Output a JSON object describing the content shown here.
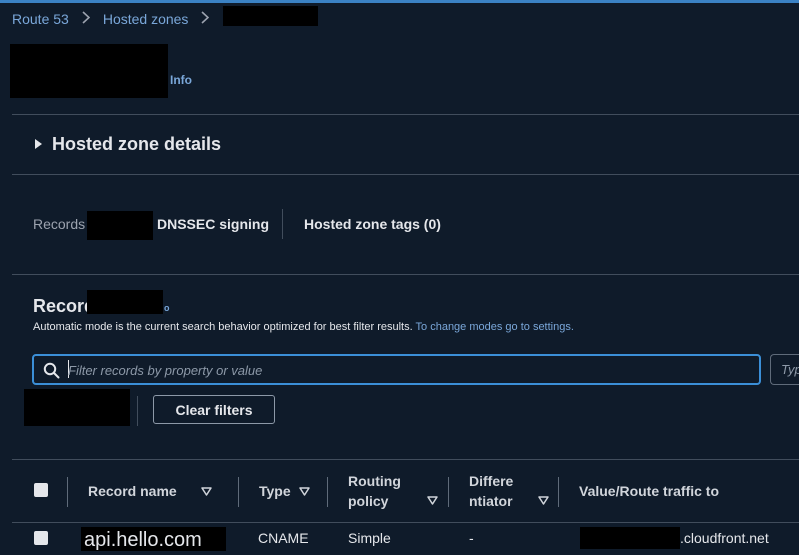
{
  "breadcrumb": {
    "items": [
      "Route 53",
      "Hosted zones"
    ]
  },
  "header": {
    "info_link": "Info"
  },
  "details_panel": {
    "title": "Hosted zone details"
  },
  "tabs": {
    "records": "Records",
    "dnssec": "DNSSEC signing",
    "tags": "Hosted zone tags (0)"
  },
  "records": {
    "title": "Records",
    "info_fragment": "o",
    "description": "Automatic mode is the current search behavior optimized for best filter results.",
    "description_link": "To change modes go to settings.",
    "search_placeholder": "Filter records by property or value",
    "type_select_fragment": "Typ",
    "clear_filters_label": "Clear filters",
    "columns": {
      "record_name": "Record name",
      "type": "Type",
      "routing_policy_line1": "Routing",
      "routing_policy_line2": "policy",
      "differentiator_line1": "Differe",
      "differentiator_line2": "ntiator",
      "value": "Value/Route traffic to"
    },
    "rows": [
      {
        "record_name": "api.hello.com",
        "type": "CNAME",
        "routing_policy": "Simple",
        "differentiator": "-",
        "value_suffix": ".cloudfront.net"
      }
    ]
  },
  "colors": {
    "background": "#0f1b2a",
    "link": "#7aa7d9",
    "focus_border": "#3b8fd8",
    "divider": "#414d5c"
  }
}
